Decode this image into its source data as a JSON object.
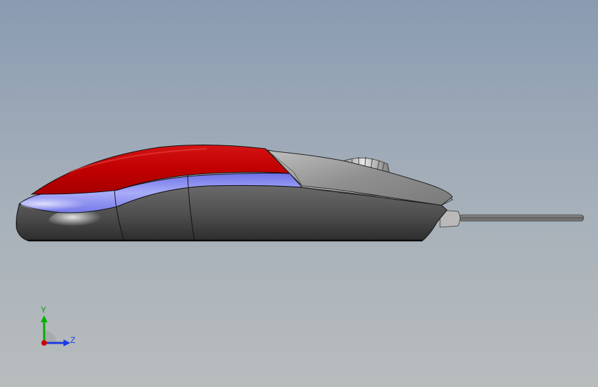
{
  "viewport": {
    "background_top": "#8c9db2",
    "background_bottom": "#b5bbbe"
  },
  "model": {
    "name": "mouse-side-view",
    "colors": {
      "shell_top": "#cc0000",
      "shell_highlight": "#f03b3b",
      "stripe": "#7a7ef0",
      "stripe_highlight": "#d8dbff",
      "body": "#5c5c5c",
      "body_dark": "#333333",
      "button": "#9a9a9a",
      "button_light": "#d6d6d6",
      "cable": "#7a7a7a"
    }
  },
  "triad": {
    "y_label": "Y",
    "z_label": "Z",
    "y_color": "#00b000",
    "z_color": "#1d3be0",
    "x_color": "#d00000",
    "label_color": "#1d3be0",
    "y_label_color": "#00a000"
  }
}
